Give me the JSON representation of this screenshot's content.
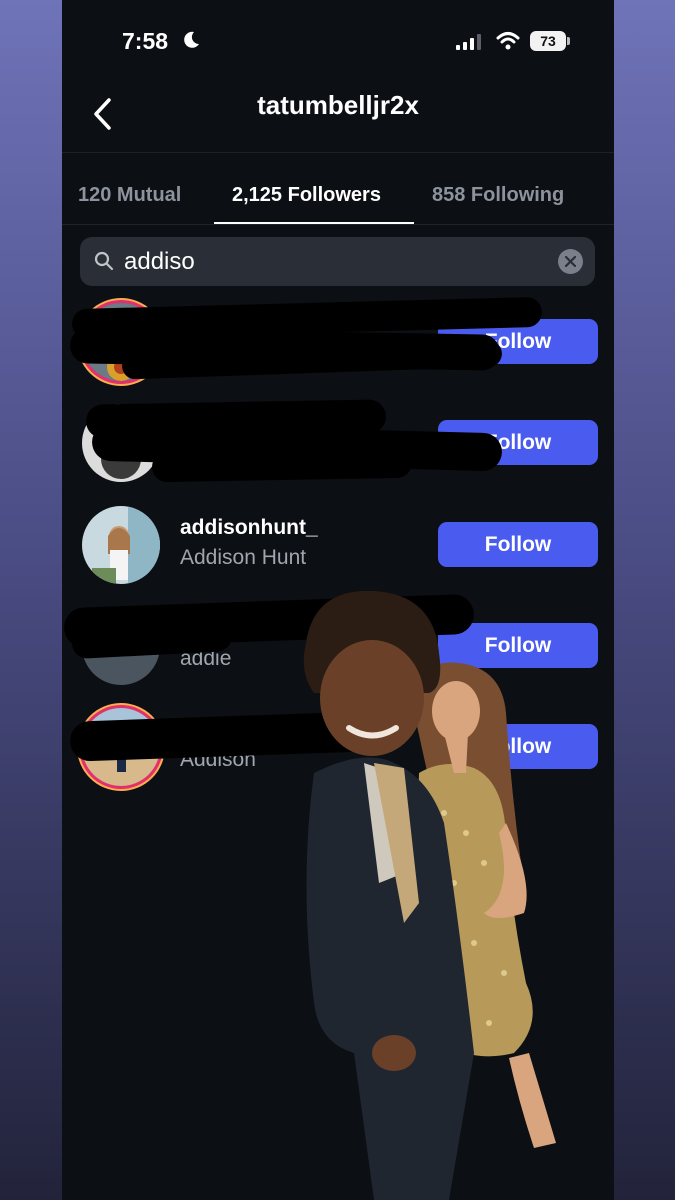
{
  "status_bar": {
    "time": "7:58",
    "battery": "73"
  },
  "header": {
    "title": "tatumbelljr2x"
  },
  "tabs": [
    {
      "label": "120 Mutual",
      "active": false
    },
    {
      "label": "2,125 Followers",
      "active": true
    },
    {
      "label": "858 Following",
      "active": false
    }
  ],
  "search": {
    "value": "addiso"
  },
  "rows": [
    {
      "username": "",
      "fullname": "",
      "button": "Follow",
      "redacted": true
    },
    {
      "username": "",
      "fullname": "",
      "button": "Follow",
      "redacted": true
    },
    {
      "username": "addisonhunt_",
      "fullname": "Addison Hunt",
      "button": "Follow",
      "redacted": false
    },
    {
      "username": "",
      "fullname": "addie",
      "button": "Follow",
      "redacted": true
    },
    {
      "username": "",
      "fullname": "Addison",
      "button": "Follow",
      "redacted": true
    }
  ],
  "colors": {
    "follow_button": "#4a5cf0",
    "background": "#0c0f14",
    "story_ring": "#e1306c"
  }
}
